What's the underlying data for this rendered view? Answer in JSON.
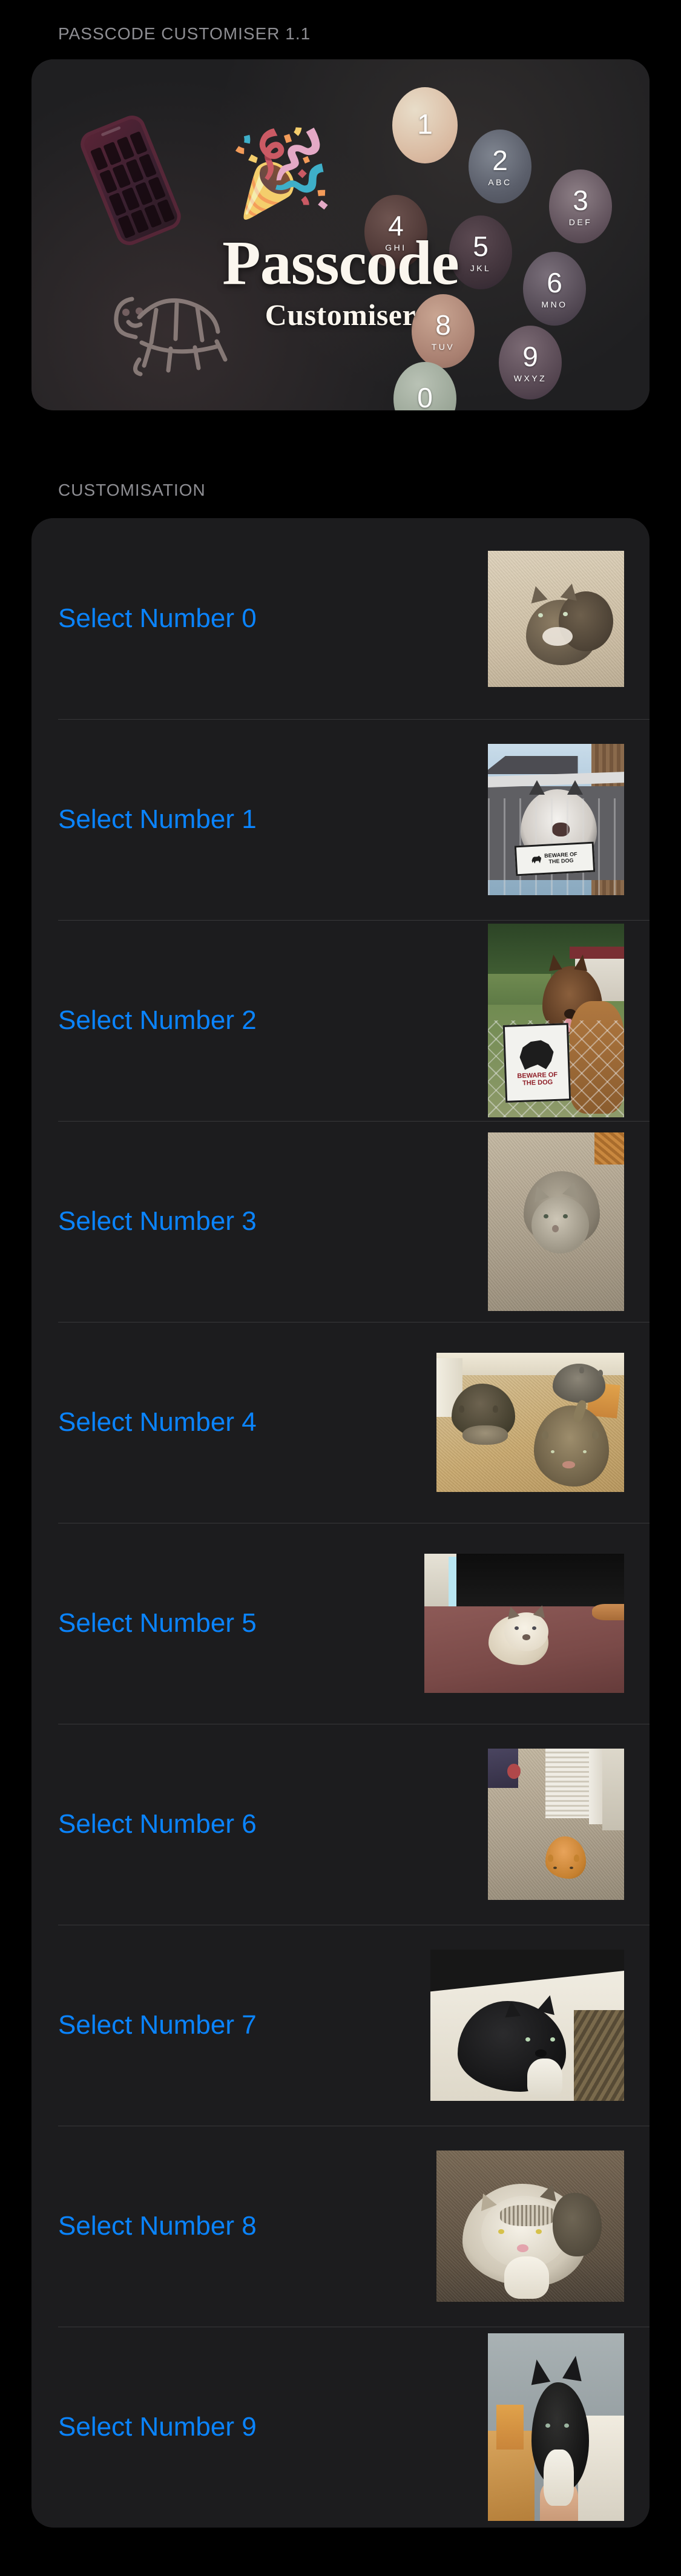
{
  "app": {
    "section_header_app": "PASSCODE CUSTOMISER 1.1",
    "section_header_customisation": "CUSTOMISATION"
  },
  "hero": {
    "wordmark_line1": "Passcode",
    "wordmark_line2": "Customiser",
    "phone_icon": "phone-keypad-icon",
    "popper_icon": "party-popper-icon",
    "popper_glyph": "🎉",
    "mascot_icon": "turtle-mascot-icon",
    "keypad": [
      {
        "digit": "1",
        "letters": ""
      },
      {
        "digit": "2",
        "letters": "ABC"
      },
      {
        "digit": "3",
        "letters": "DEF"
      },
      {
        "digit": "4",
        "letters": "GHI"
      },
      {
        "digit": "5",
        "letters": "JKL"
      },
      {
        "digit": "6",
        "letters": "MNO"
      },
      {
        "digit": "8",
        "letters": "TUV"
      },
      {
        "digit": "9",
        "letters": "WXYZ"
      },
      {
        "digit": "0",
        "letters": ""
      }
    ]
  },
  "colors": {
    "background": "#000000",
    "card": "#1C1C1E",
    "separator": "#38383A",
    "accent_link": "#0A84FF",
    "header_text": "#8E8E93"
  },
  "customisation_rows": [
    {
      "label": "Select Number 0",
      "thumb_name": "thumbnail-number-0",
      "thumb_alt": "Tabby kitten sitting on light carpet",
      "orientation": "portrait"
    },
    {
      "label": "Select Number 1",
      "thumb_name": "thumbnail-number-1",
      "thumb_alt": "Husky dog behind metal gate with BEWARE OF THE DOG sign",
      "orientation": "portrait"
    },
    {
      "label": "Select Number 2",
      "thumb_name": "thumbnail-number-2",
      "thumb_alt": "German Shepherd behind chain-link fence with BEWARE OF THE DOG sign",
      "orientation": "portrait"
    },
    {
      "label": "Select Number 3",
      "thumb_name": "thumbnail-number-3",
      "thumb_alt": "Fluffy grey kitten curled on carpet",
      "orientation": "portrait"
    },
    {
      "label": "Select Number 4",
      "thumb_name": "thumbnail-number-4",
      "thumb_alt": "Three tabby cats resting on tan carpet hallway",
      "orientation": "landscape"
    },
    {
      "label": "Select Number 5",
      "thumb_name": "thumbnail-number-5",
      "thumb_alt": "Cream ragdoll kitten on a maroon bed",
      "orientation": "landscape"
    },
    {
      "label": "Select Number 6",
      "thumb_name": "thumbnail-number-6",
      "thumb_alt": "Ginger cat lying on carpet beside a white door",
      "orientation": "portrait"
    },
    {
      "label": "Select Number 7",
      "thumb_name": "thumbnail-number-7",
      "thumb_alt": "Black and white tuxedo cat on a white blanket",
      "orientation": "landscape"
    },
    {
      "label": "Select Number 8",
      "thumb_name": "thumbnail-number-8",
      "thumb_alt": "Tabby and white cat lying upside down on carpet",
      "orientation": "landscape"
    },
    {
      "label": "Select Number 9",
      "thumb_name": "thumbnail-number-9",
      "thumb_alt": "Black and white kitten being held up",
      "orientation": "portrait"
    }
  ],
  "sign_text": {
    "line1": "BEWARE OF",
    "line2": "THE DOG"
  }
}
